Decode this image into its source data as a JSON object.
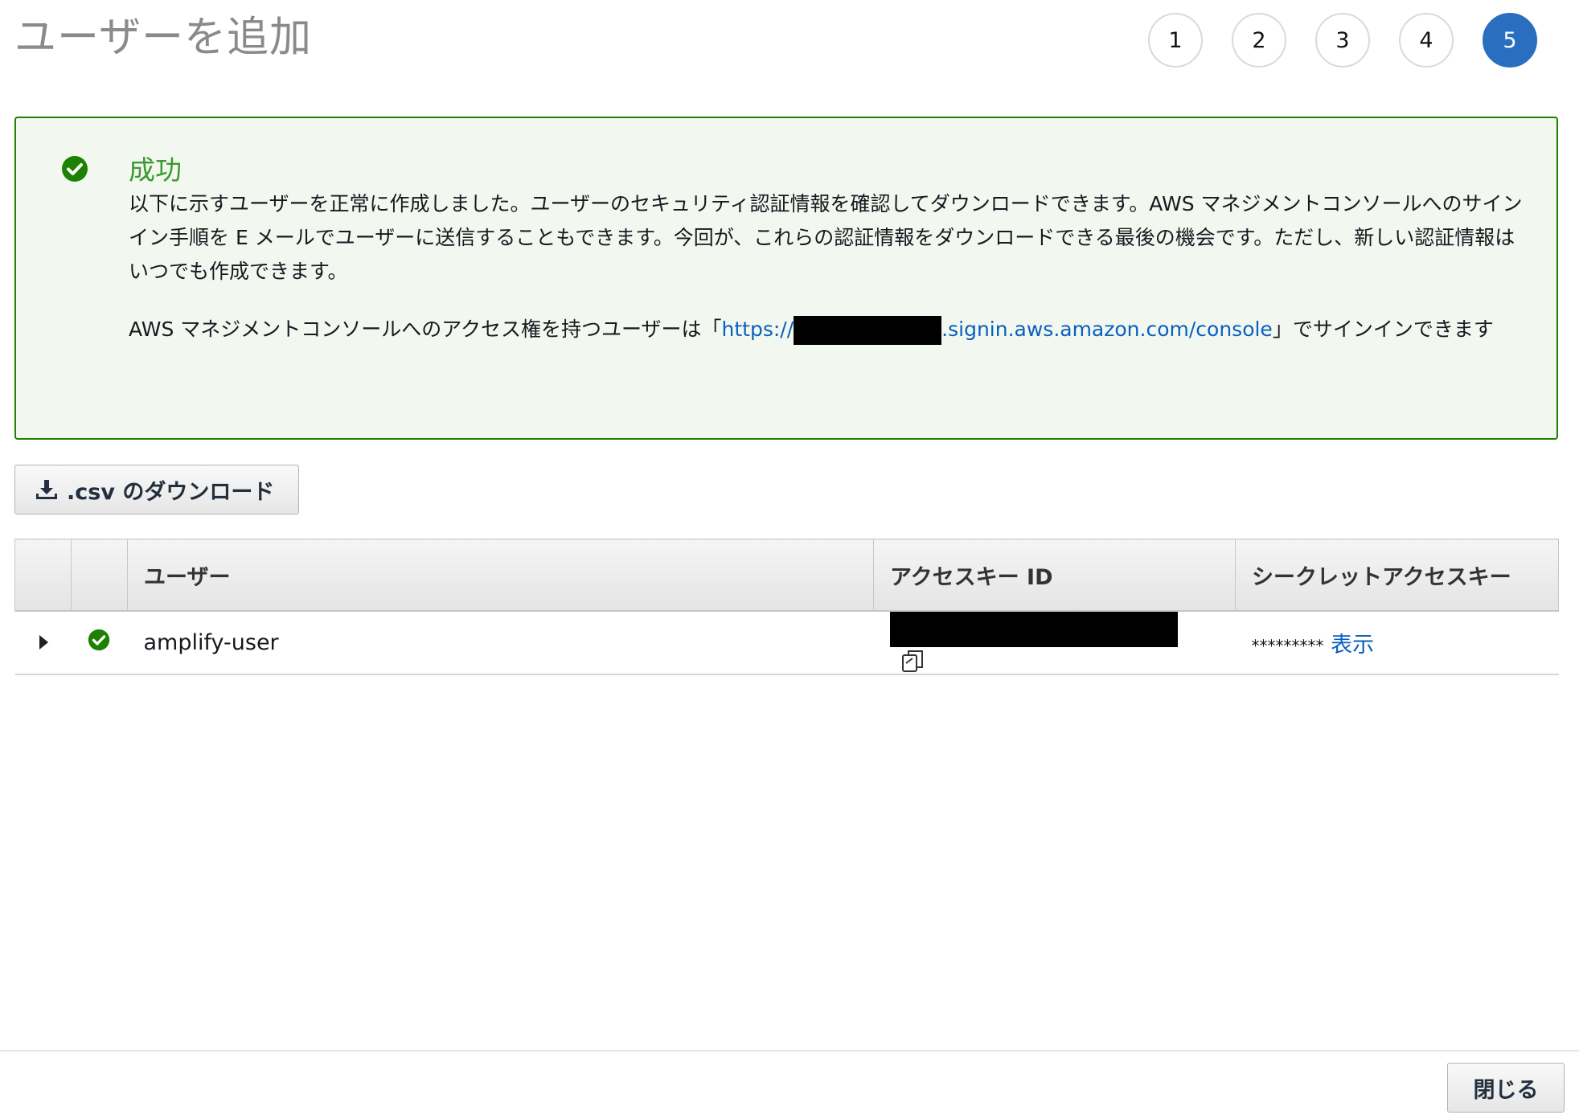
{
  "page": {
    "title": "ユーザーを追加"
  },
  "steps": [
    {
      "label": "1",
      "active": false
    },
    {
      "label": "2",
      "active": false
    },
    {
      "label": "3",
      "active": false
    },
    {
      "label": "4",
      "active": false
    },
    {
      "label": "5",
      "active": true
    }
  ],
  "alert": {
    "icon": "check-circle-icon",
    "title": "成功",
    "message": "以下に示すユーザーを正常に作成しました。ユーザーのセキュリティ認証情報を確認してダウンロードできます。AWS マネジメントコンソールへのサインイン手順を E メールでユーザーに送信することもできます。今回が、これらの認証情報をダウンロードできる最後の機会です。ただし、新しい認証情報はいつでも作成できます。",
    "access_prefix": "AWS マネジメントコンソールへのアクセス権を持つユーザーは「",
    "url_start": "https://",
    "url_end": ".signin.aws.amazon.com/console",
    "access_suffix": "」でサインインできます"
  },
  "toolbar": {
    "download_label": ".csv のダウンロード",
    "download_icon": "download-icon"
  },
  "table": {
    "columns": [
      "",
      "",
      "ユーザー",
      "アクセスキー ID",
      "シークレットアクセスキー"
    ],
    "rows": [
      {
        "user": "amplify-user",
        "status_icon": "check-circle-icon",
        "access_key_id": "[redacted]",
        "secret_masked": "*********",
        "show_label": "表示"
      }
    ]
  },
  "footer": {
    "close_label": "閉じる"
  },
  "colors": {
    "success": "#1d8102",
    "link": "#0a5fbf",
    "active_step": "#2a6fbf"
  }
}
